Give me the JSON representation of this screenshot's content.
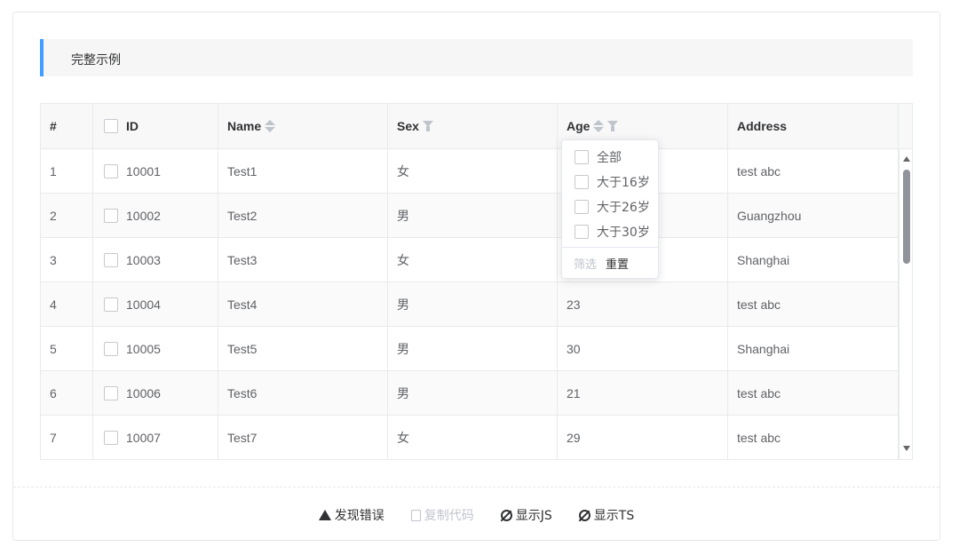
{
  "section": {
    "title": "完整示例"
  },
  "table": {
    "columns": {
      "index": "#",
      "id": "ID",
      "name": "Name",
      "sex": "Sex",
      "age": "Age",
      "address": "Address"
    },
    "rows": [
      {
        "index": "1",
        "id": "10001",
        "name": "Test1",
        "sex": "女",
        "age": "",
        "address": "test abc"
      },
      {
        "index": "2",
        "id": "10002",
        "name": "Test2",
        "sex": "男",
        "age": "",
        "address": "Guangzhou"
      },
      {
        "index": "3",
        "id": "10003",
        "name": "Test3",
        "sex": "女",
        "age": "",
        "address": "Shanghai"
      },
      {
        "index": "4",
        "id": "10004",
        "name": "Test4",
        "sex": "男",
        "age": "23",
        "address": "test abc"
      },
      {
        "index": "5",
        "id": "10005",
        "name": "Test5",
        "sex": "男",
        "age": "30",
        "address": "Shanghai"
      },
      {
        "index": "6",
        "id": "10006",
        "name": "Test6",
        "sex": "男",
        "age": "21",
        "address": "test abc"
      },
      {
        "index": "7",
        "id": "10007",
        "name": "Test7",
        "sex": "女",
        "age": "29",
        "address": "test abc"
      }
    ]
  },
  "age_filter": {
    "options": [
      "全部",
      "大于16岁",
      "大于26岁",
      "大于30岁"
    ],
    "confirm_label": "筛选",
    "reset_label": "重置"
  },
  "footer": {
    "report_label": "发现错误",
    "copy_label": "复制代码",
    "show_js_label": "显示JS",
    "show_ts_label": "显示TS"
  },
  "colors": {
    "accent": "#409eff",
    "header_bg": "#f8f8f9",
    "border": "#e8eaec"
  }
}
